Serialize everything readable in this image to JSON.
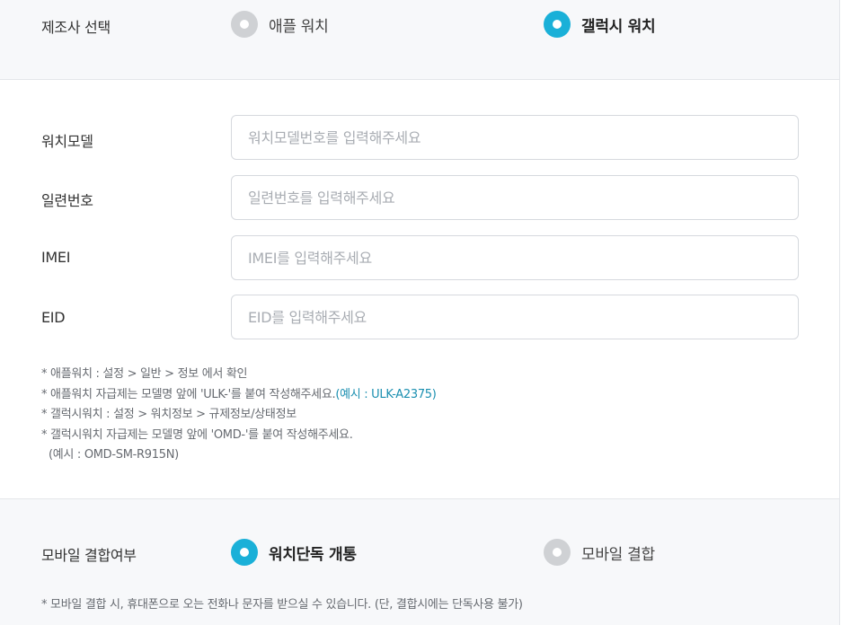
{
  "manufacturer": {
    "label": "제조사 선택",
    "options": [
      {
        "label": "애플 워치",
        "selected": false
      },
      {
        "label": "갤럭시 워치",
        "selected": true
      }
    ]
  },
  "fields": [
    {
      "label": "워치모델",
      "placeholder": "워치모델번호를 입력해주세요",
      "value": ""
    },
    {
      "label": "일련번호",
      "placeholder": "일련번호를 입력해주세요",
      "value": ""
    },
    {
      "label": "IMEI",
      "placeholder": "IMEI를 입력해주세요",
      "value": ""
    },
    {
      "label": "EID",
      "placeholder": "EID를 입력해주세요",
      "value": ""
    }
  ],
  "notes": {
    "line1": "* 애플워치 : 설정 > 일반 > 정보 에서 확인",
    "line2": "* 애플워치 자급제는 모델명 앞에 'ULK-'를 붙여 작성해주세요.",
    "line2_example": "(예시 : ULK-A2375)",
    "line3": "* 갤럭시워치 : 설정 > 워치정보 > 규제정보/상태정보",
    "line4": "* 갤럭시워치 자급제는 모델명 앞에 'OMD-'를 붙여 작성해주세요.",
    "line5": "(예시 : OMD-SM-R915N)"
  },
  "mobile": {
    "label": "모바일 결합여부",
    "options": [
      {
        "label": "워치단독 개통",
        "selected": true
      },
      {
        "label": "모바일 결합",
        "selected": false
      }
    ],
    "note": "* 모바일 결합 시, 휴대폰으로 오는 전화나 문자를 받으실 수 있습니다. (단, 결합시에는 단독사용 불가)"
  },
  "colors": {
    "accent": "#1ab0d8",
    "radio_off": "#cfd1d4",
    "highlight_text": "#1a8fb0",
    "section_bg": "#f7f8fa"
  }
}
